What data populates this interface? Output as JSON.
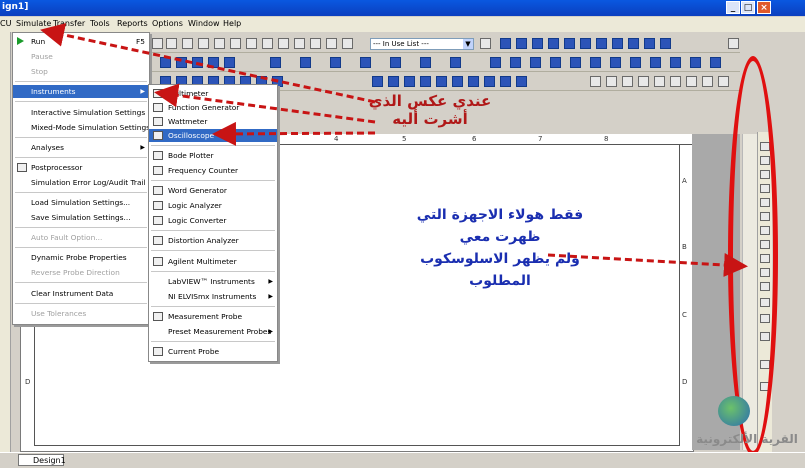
{
  "window": {
    "title": "ign1]"
  },
  "menubar": [
    "CU",
    "Simulate",
    "Transfer",
    "Tools",
    "Reports",
    "Options",
    "Window",
    "Help"
  ],
  "toolbar": {
    "combo_value": "--- In Use List ---"
  },
  "ruler": {
    "cols": [
      "4",
      "5",
      "6",
      "7",
      "8"
    ],
    "rows": [
      "A",
      "B",
      "C",
      "D",
      "D"
    ]
  },
  "tabs": [
    {
      "label": "Design1"
    }
  ],
  "simulate_menu": {
    "run": "Run",
    "run_shortcut": "F5",
    "pause": "Pause",
    "stop": "Stop",
    "instruments": "Instruments",
    "interactive": "Interactive Simulation Settings",
    "mixed_mode": "Mixed-Mode Simulation Settings",
    "analyses": "Analyses",
    "postprocessor": "Postprocessor",
    "error_log": "Simulation Error Log/Audit Trail",
    "load_settings": "Load Simulation Settings...",
    "save_settings": "Save Simulation Settings...",
    "auto_fault": "Auto Fault Option...",
    "dynamic_probe": "Dynamic Probe Properties",
    "reverse_probe": "Reverse Probe Direction",
    "clear_instrument": "Clear Instrument Data",
    "use_tolerances": "Use Tolerances"
  },
  "instruments_menu": {
    "multimeter": "Multimeter",
    "function_generator": "Function Generator",
    "wattmeter": "Wattmeter",
    "oscilloscope": "Oscilloscope",
    "bode_plotter": "Bode Plotter",
    "frequency_counter": "Frequency Counter",
    "word_generator": "Word Generator",
    "logic_analyzer": "Logic Analyzer",
    "logic_converter": "Logic Converter",
    "distortion_analyzer": "Distortion Analyzer",
    "agilent_multimeter": "Agilent Multimeter",
    "labview": "LabVIEW™ Instruments",
    "ni_elvismx": "NI ELVISmx Instruments",
    "measurement_probe": "Measurement Probe",
    "preset_probes": "Preset Measurement Probes",
    "current_probe": "Current Probe"
  },
  "annotations": {
    "note1_line1": "عندي عكس الذي",
    "note1_line2": "أشرت أليه",
    "note2_line1": "فقط هولاء الاجهزة التي",
    "note2_line2": "ظهرت معي",
    "note2_line3": "ولم يظهر الاسلوسكوب",
    "note2_line4": "المطلوب"
  },
  "watermark": {
    "text": "القرية الألكترونية"
  },
  "colors": {
    "annotation_red": "#b01818",
    "annotation_blue": "#1a2eb0",
    "highlight": "#316ac5",
    "circle": "#e01010"
  }
}
